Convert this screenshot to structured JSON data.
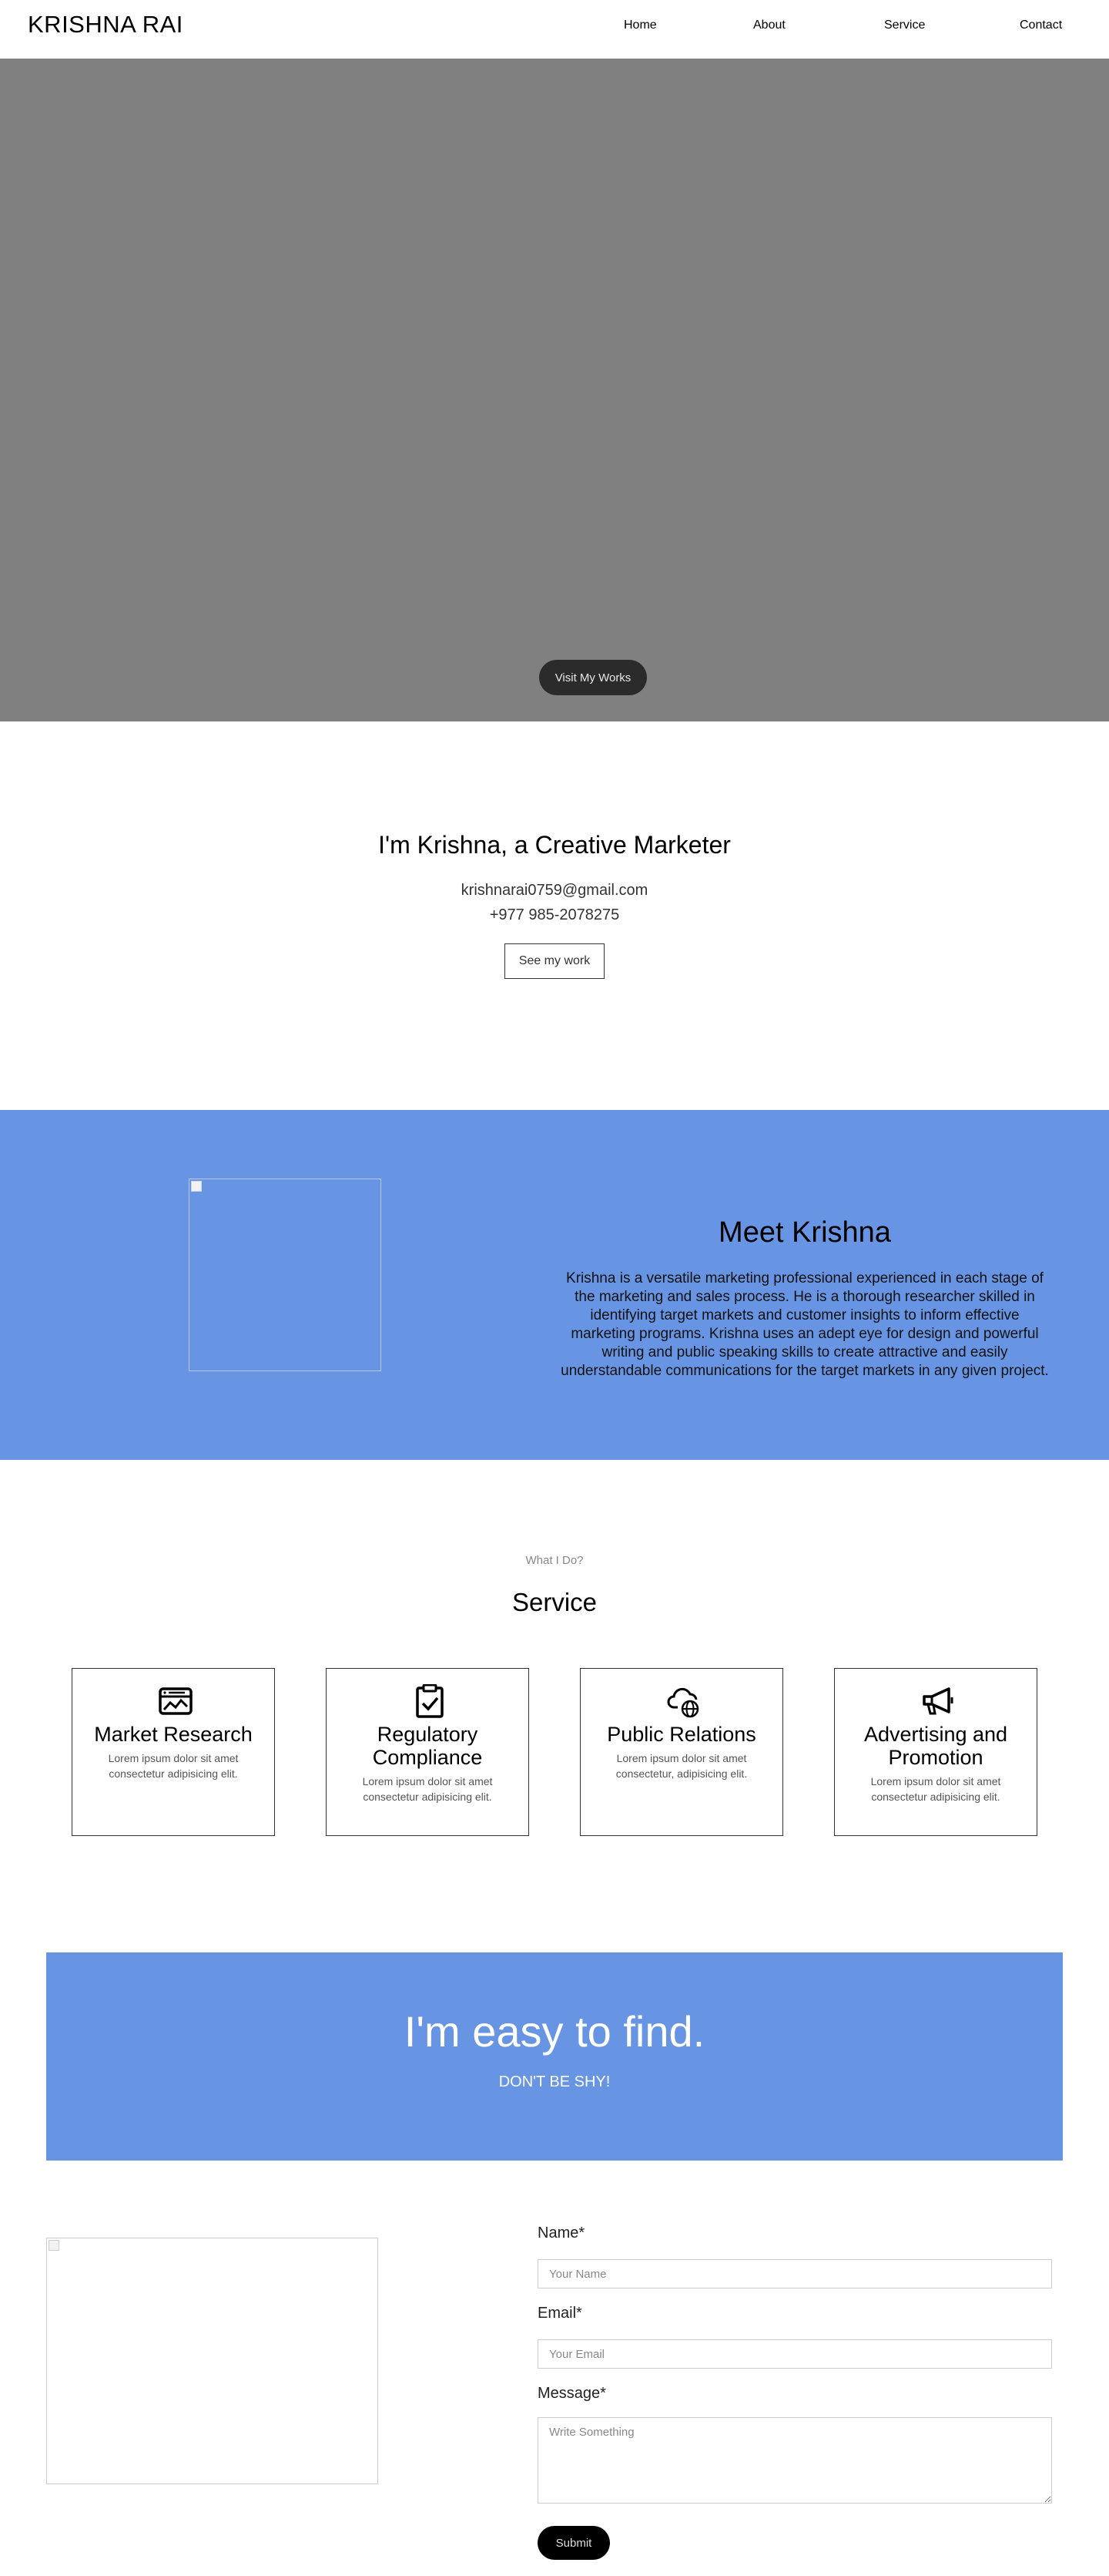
{
  "header": {
    "logo": "KRISHNA RAI",
    "nav": [
      "Home",
      "About",
      "Service",
      "Contact"
    ]
  },
  "hero": {
    "button_label": "Visit My Works"
  },
  "intro": {
    "title": "I'm Krishna, a Creative Marketer",
    "email": "krishnarai0759@gmail.com",
    "phone": "+977 985-2078275",
    "button_label": "See my work"
  },
  "meet": {
    "title": "Meet Krishna",
    "text": "Krishna is a versatile marketing professional experienced in each stage of the marketing and sales process. He is a thorough researcher skilled in identifying target markets and customer insights to inform effective marketing programs. Krishna uses an adept eye for design and powerful writing and public speaking skills to create attractive and easily understandable communications for the target markets in any given project."
  },
  "services": {
    "kicker": "What I Do?",
    "title": "Service",
    "items": [
      {
        "icon": "market-research-icon",
        "title": "Market Research",
        "text": "Lorem ipsum dolor sit amet consectetur adipisicing elit."
      },
      {
        "icon": "clipboard-check-icon",
        "title": "Regulatory Compliance",
        "text": "Lorem ipsum dolor sit amet consectetur adipisicing elit."
      },
      {
        "icon": "cloud-globe-icon",
        "title": "Public Relations",
        "text": "Lorem ipsum dolor sit amet consectetur, adipisicing elit."
      },
      {
        "icon": "megaphone-icon",
        "title": "Advertising and Promotion",
        "text": "Lorem ipsum dolor sit amet consectetur adipisicing elit."
      }
    ]
  },
  "find": {
    "title": "I'm easy to find.",
    "subtitle": "DON'T BE SHY!"
  },
  "contact": {
    "name_label": "Name*",
    "name_placeholder": "Your Name",
    "email_label": "Email*",
    "email_placeholder": "Your Email",
    "message_label": "Message*",
    "message_placeholder": "Write Something",
    "submit_label": "Submit"
  },
  "colors": {
    "accent_blue": "#6795e4",
    "hero_gray": "#808080",
    "dark_button": "#2b2b2b"
  }
}
